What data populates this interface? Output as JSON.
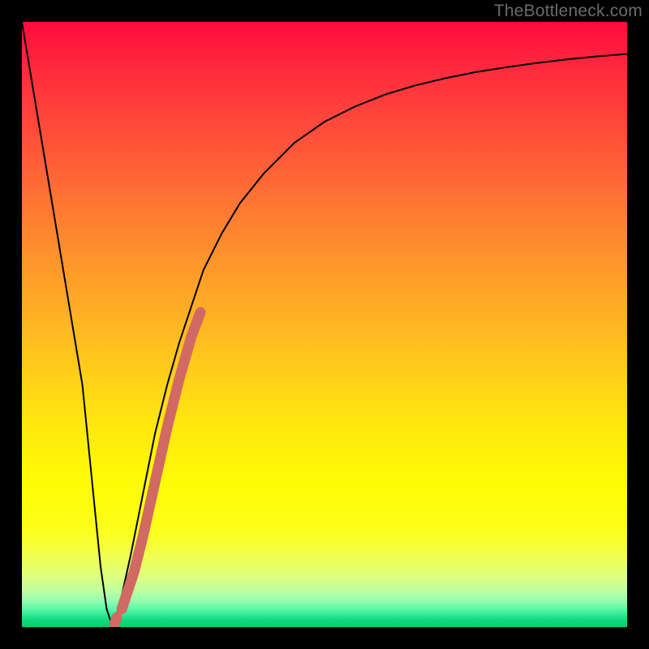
{
  "watermark": "TheBottleneck.com",
  "chart_data": {
    "type": "line",
    "title": "",
    "xlabel": "",
    "ylabel": "",
    "xlim": [
      0,
      100
    ],
    "ylim": [
      0,
      100
    ],
    "grid": false,
    "series": [
      {
        "name": "bottleneck-curve",
        "stroke": "#000000",
        "stroke_width": 2,
        "x": [
          0,
          2,
          4,
          6,
          8,
          10,
          11,
          12,
          13,
          14,
          15,
          16,
          18,
          20,
          22,
          24,
          26,
          28,
          30,
          33,
          36,
          40,
          45,
          50,
          55,
          60,
          65,
          70,
          75,
          80,
          85,
          90,
          95,
          100
        ],
        "y": [
          100,
          88,
          76,
          64,
          52,
          40,
          30,
          20,
          10,
          3,
          0,
          3,
          12,
          22,
          32,
          40,
          47,
          53,
          59,
          65,
          70,
          75,
          80,
          83.5,
          86,
          88,
          89.5,
          90.7,
          91.7,
          92.5,
          93.2,
          93.8,
          94.3,
          94.7
        ]
      },
      {
        "name": "highlight-segment",
        "stroke": "#d06a63",
        "stroke_width": 13,
        "linecap": "round",
        "x": [
          16.5,
          17.5,
          18.5,
          20.0,
          22.0,
          24.0,
          26.0,
          28.0,
          29.5
        ],
        "y": [
          3.0,
          6.0,
          9.0,
          15.0,
          24.0,
          33.0,
          41.0,
          48.0,
          52.0
        ]
      },
      {
        "name": "highlight-dot",
        "stroke": "#d06a63",
        "stroke_width": 13,
        "linecap": "round",
        "x": [
          15.3,
          15.7
        ],
        "y": [
          0.6,
          1.6
        ]
      }
    ],
    "background_gradient": {
      "top": "#ff0a3e",
      "mid": "#fffb05",
      "bottom": "#0acb6e"
    }
  }
}
